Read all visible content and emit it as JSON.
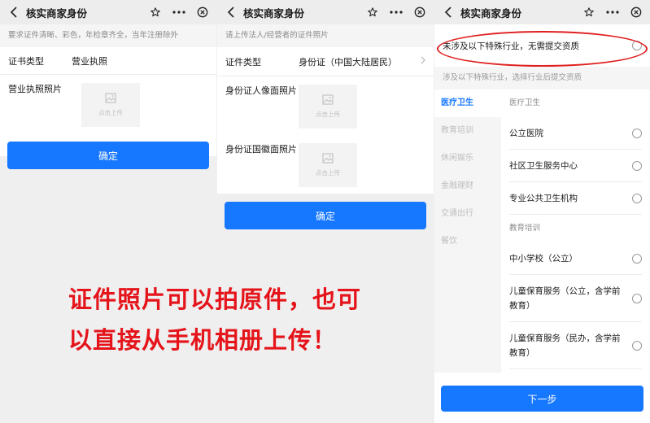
{
  "nav_title": "核实商家身份",
  "panel1": {
    "hint": "要求证件清晰、彩色，年检章齐全，当年注册除外",
    "cert_type_label": "证书类型",
    "cert_type_value": "营业执照",
    "photo_label": "营业执照照片",
    "upload_text": "点击上传",
    "confirm": "确定"
  },
  "panel2": {
    "hint": "请上传法人/经营者的证件照片",
    "cert_type_label": "证件类型",
    "cert_type_value": "身份证（中国大陆居民）",
    "front_label": "身份证人像面照片",
    "back_label": "身份证国徽面照片",
    "upload_text": "点击上传",
    "confirm": "确定"
  },
  "panel3": {
    "none_option": "未涉及以下特殊行业，无需提交资质",
    "hint": "涉及以下特殊行业，选择行业后提交资质",
    "categories": [
      "医疗卫生",
      "教育培训",
      "休闲娱乐",
      "金融理财",
      "交通出行",
      "餐饮"
    ],
    "section_medical": "医疗卫生",
    "medical_items": [
      "公立医院",
      "社区卫生服务中心",
      "专业公共卫生机构"
    ],
    "section_education": "教育培训",
    "education_items": [
      "中小学校（公立）",
      "儿童保育服务（公立，含学前教育）",
      "儿童保育服务（民办，含学前教育）"
    ],
    "next": "下一步"
  },
  "overlay": {
    "line1": "证件照片可以拍原件，也可",
    "line2": "以直接从手机相册上传！"
  },
  "colors": {
    "primary": "#1677ff",
    "annotation": "#e5141b"
  }
}
